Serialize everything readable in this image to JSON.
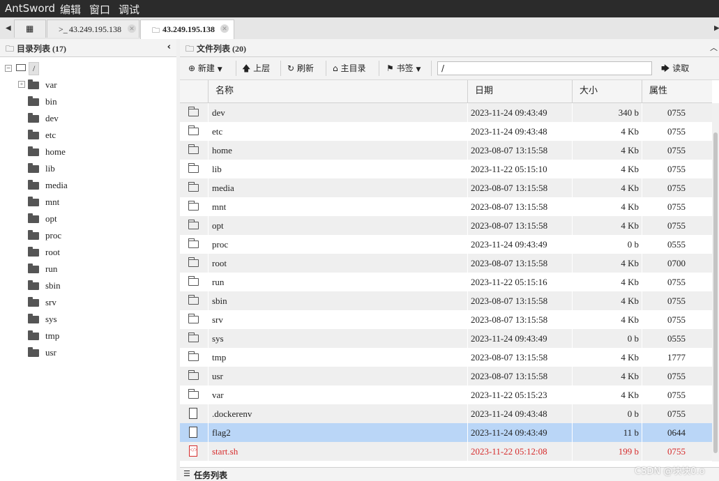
{
  "menubar": {
    "app": "AntSword",
    "items": [
      "编辑",
      "窗口",
      "调试"
    ]
  },
  "tabs": [
    {
      "icon": ">_",
      "label": "43.249.195.138"
    },
    {
      "icon": "folder",
      "label": "43.249.195.138"
    }
  ],
  "left_panel": {
    "title": "目录列表 (17)",
    "root": "/",
    "items": [
      "var",
      "bin",
      "dev",
      "etc",
      "home",
      "lib",
      "media",
      "mnt",
      "opt",
      "proc",
      "root",
      "run",
      "sbin",
      "srv",
      "sys",
      "tmp",
      "usr"
    ]
  },
  "right_panel": {
    "title": "文件列表 (20)",
    "toolbar": {
      "new": "新建",
      "up": "上层",
      "refresh": "刷新",
      "home": "主目录",
      "bookmark": "书签",
      "path": "/",
      "read": "读取"
    },
    "columns": [
      "名称",
      "日期",
      "大小",
      "属性"
    ],
    "rows": [
      {
        "name": "dev",
        "date": "2023-11-24 09:43:49",
        "size": "340 b",
        "attr": "0755",
        "type": "dir"
      },
      {
        "name": "etc",
        "date": "2023-11-24 09:43:48",
        "size": "4 Kb",
        "attr": "0755",
        "type": "dir"
      },
      {
        "name": "home",
        "date": "2023-08-07 13:15:58",
        "size": "4 Kb",
        "attr": "0755",
        "type": "dir"
      },
      {
        "name": "lib",
        "date": "2023-11-22 05:15:10",
        "size": "4 Kb",
        "attr": "0755",
        "type": "dir"
      },
      {
        "name": "media",
        "date": "2023-08-07 13:15:58",
        "size": "4 Kb",
        "attr": "0755",
        "type": "dir"
      },
      {
        "name": "mnt",
        "date": "2023-08-07 13:15:58",
        "size": "4 Kb",
        "attr": "0755",
        "type": "dir"
      },
      {
        "name": "opt",
        "date": "2023-08-07 13:15:58",
        "size": "4 Kb",
        "attr": "0755",
        "type": "dir"
      },
      {
        "name": "proc",
        "date": "2023-11-24 09:43:49",
        "size": "0 b",
        "attr": "0555",
        "type": "dir"
      },
      {
        "name": "root",
        "date": "2023-08-07 13:15:58",
        "size": "4 Kb",
        "attr": "0700",
        "type": "dir"
      },
      {
        "name": "run",
        "date": "2023-11-22 05:15:16",
        "size": "4 Kb",
        "attr": "0755",
        "type": "dir"
      },
      {
        "name": "sbin",
        "date": "2023-08-07 13:15:58",
        "size": "4 Kb",
        "attr": "0755",
        "type": "dir"
      },
      {
        "name": "srv",
        "date": "2023-08-07 13:15:58",
        "size": "4 Kb",
        "attr": "0755",
        "type": "dir"
      },
      {
        "name": "sys",
        "date": "2023-11-24 09:43:49",
        "size": "0 b",
        "attr": "0555",
        "type": "dir"
      },
      {
        "name": "tmp",
        "date": "2023-08-07 13:15:58",
        "size": "4 Kb",
        "attr": "1777",
        "type": "dir"
      },
      {
        "name": "usr",
        "date": "2023-08-07 13:15:58",
        "size": "4 Kb",
        "attr": "0755",
        "type": "dir"
      },
      {
        "name": "var",
        "date": "2023-11-22 05:15:23",
        "size": "4 Kb",
        "attr": "0755",
        "type": "dir"
      },
      {
        "name": ".dockerenv",
        "date": "2023-11-24 09:43:48",
        "size": "0 b",
        "attr": "0755",
        "type": "file"
      },
      {
        "name": "flag2",
        "date": "2023-11-24 09:43:49",
        "size": "11 b",
        "attr": "0644",
        "type": "file",
        "selected": true
      },
      {
        "name": "start.sh",
        "date": "2023-11-22 05:12:08",
        "size": "199 b",
        "attr": "0755",
        "type": "script",
        "highlight": true
      }
    ]
  },
  "task_panel": {
    "title": "任务列表"
  },
  "watermark": "CSDN @块块0.o"
}
